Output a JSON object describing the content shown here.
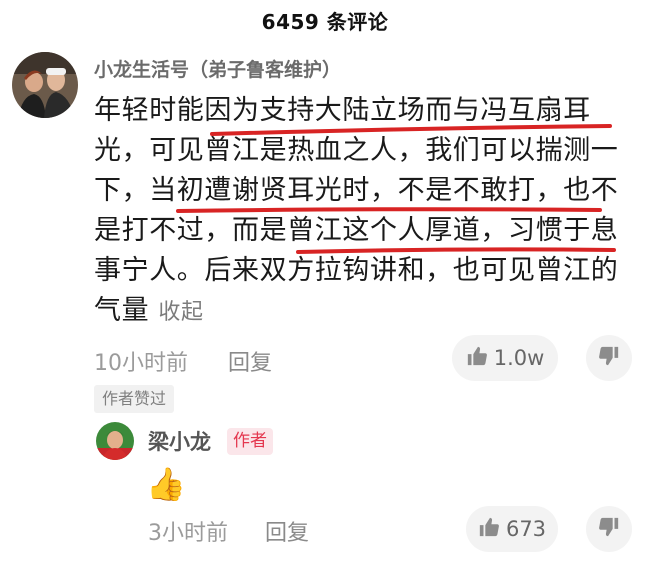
{
  "header": {
    "title": "6459 条评论"
  },
  "comment": {
    "username": "小龙生活号（弟子鲁客维护）",
    "text": "年轻时能因为支持大陆立场而与冯互扇耳光，可见曾江是热血之人，我们可以揣测一下，当初遭谢贤耳光时，不是不敢打，也不是打不过，而是曾江这个人厚道，习惯于息事宁人。后来双方拉钩讲和，也可见曾江的气量",
    "collapse_label": "收起",
    "time": "10小时前",
    "reply_label": "回复",
    "like_count": "1.0w",
    "author_liked_tag": "作者赞过",
    "like_icon": "thumbs-up-icon",
    "dislike_icon": "thumbs-down-icon"
  },
  "reply": {
    "username": "梁小龙",
    "badge": "作者",
    "content_emoji": "👍",
    "time": "3小时前",
    "reply_label": "回复",
    "like_count": "673"
  },
  "colors": {
    "underline": "#d82424",
    "badge_bg": "#fbe6ea",
    "badge_text": "#e4374f",
    "pill_bg": "#f3f3f3",
    "meta_text": "#9b9b9b"
  }
}
